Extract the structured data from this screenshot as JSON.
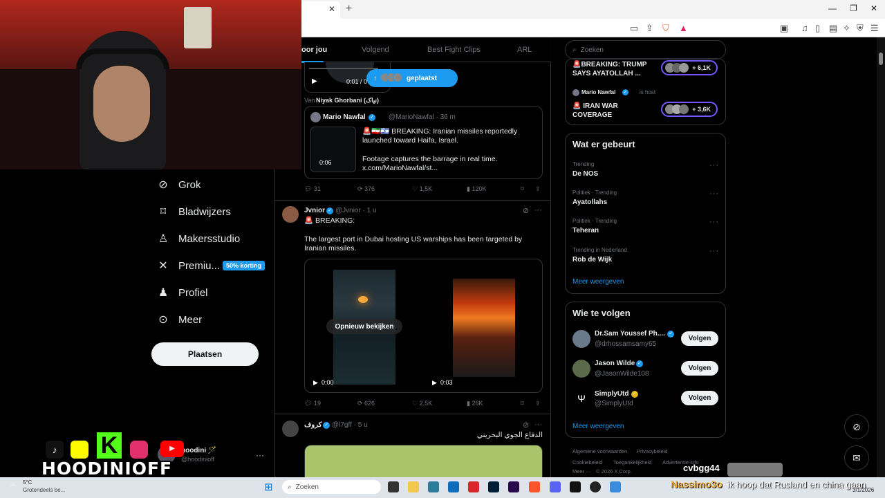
{
  "browser": {
    "tab_close": "✕",
    "new_tab": "+",
    "win_min": "—",
    "win_max": "❐",
    "win_close": "✕"
  },
  "feed_tabs": [
    "oor jou",
    "Volgend",
    "Best Fight Clips",
    "ARL"
  ],
  "new_posts_pill": "geplaatst",
  "left_nav": {
    "items": [
      {
        "label": "Grok",
        "icon": "grok-icon"
      },
      {
        "label": "Bladwijzers",
        "icon": "bookmark-icon"
      },
      {
        "label": "Makersstudio",
        "icon": "flask-icon"
      },
      {
        "label": "Premiu...",
        "icon": "x-logo-icon"
      },
      {
        "label": "Profiel",
        "icon": "person-icon"
      },
      {
        "label": "Meer",
        "icon": "more-circle-icon"
      }
    ],
    "premium_badge": "50% korting",
    "post_button": "Plaatsen"
  },
  "post1": {
    "video_time": "0:01 / 0",
    "via": "Van",
    "via_name": "Niyak Ghorbani (نیاک)",
    "quote": {
      "name": "Mario Nawfal",
      "handle": "@MarioNawfal · 36 m",
      "text1": "🚨🇮🇷🇮🇱 BREAKING: Iranian missiles reportedly launched toward Haifa, Israel.",
      "text2": "Footage captures the barrage in real time.",
      "text3": " x.com/MarioNawfal/st...",
      "video_time": "0:06"
    },
    "stats": {
      "replies": "31",
      "reposts": "376",
      "likes": "1,5K",
      "views": "120K"
    }
  },
  "post2": {
    "name": "Jvnior",
    "handle": "@Jvnior · 1 u",
    "line1": "🚨 BREAKING:",
    "text": "The largest port in Dubai hosting US warships has been targeted by Iranian missiles.",
    "replay": "Opnieuw bekijken",
    "video1_time": "0:00",
    "video2_time": "0:03",
    "stats": {
      "replies": "19",
      "reposts": "626",
      "likes": "2,5K",
      "views": "26K"
    }
  },
  "post3": {
    "name": "كروف",
    "handle": "@l7gff · 5 u",
    "text": "الدفاع الجوي البحريني"
  },
  "sidebar": {
    "search_placeholder": "Zoeken",
    "live1": {
      "title": "🚨BREAKING: TRUMP SAYS AYATOLLAH ...",
      "count": "+ 6,1K"
    },
    "live2": {
      "host": "Mario Nawfal",
      "host_suffix": "is host",
      "title": "🚨 IRAN WAR COVERAGE",
      "count": "+ 3,6K"
    },
    "trending_title": "Wat er gebeurt",
    "trends": [
      {
        "meta": "Trending",
        "name": "De NOS"
      },
      {
        "meta": "Politiek · Trending",
        "name": "Ayatollahs"
      },
      {
        "meta": "Politiek · Trending",
        "name": "Teheran"
      },
      {
        "meta": "Trending in Nederland",
        "name": "Rob de Wijk"
      }
    ],
    "show_more": "Meer weergeven",
    "follow_title": "Wie te volgen",
    "follow": [
      {
        "name": "Dr.Sam Youssef Ph....",
        "handle": "@drhossamsamy65",
        "button": "Volgen"
      },
      {
        "name": "Jason Wilde",
        "handle": "@JasonWilde108",
        "button": "Volgen"
      },
      {
        "name": "SimplyUtd",
        "handle": "@SimplyUtd",
        "button": "Volgen"
      }
    ],
    "show_more2": "Meer weergeven",
    "footer": [
      "Algemene voorwaarden",
      "Privacybeleid",
      "Cookiebeleid",
      "Toegankelijkheid",
      "Advertentie-info",
      "Meer ···",
      "© 2026 X Corp."
    ]
  },
  "account": {
    "name": "hoodini 🪄",
    "handle": "@hoodinioff",
    "more": "···"
  },
  "overlay": {
    "brand": "HOODINIOFF",
    "chat_user": "Nassimo3o",
    "chat_text": "ik hoop dat Rusland en china gaan",
    "chat_name2": "cvbgg44"
  },
  "taskbar": {
    "weather_temp": "5°C",
    "weather_desc": "Grotendeels be...",
    "search": "Zoeken",
    "date": "3/1/2026"
  }
}
